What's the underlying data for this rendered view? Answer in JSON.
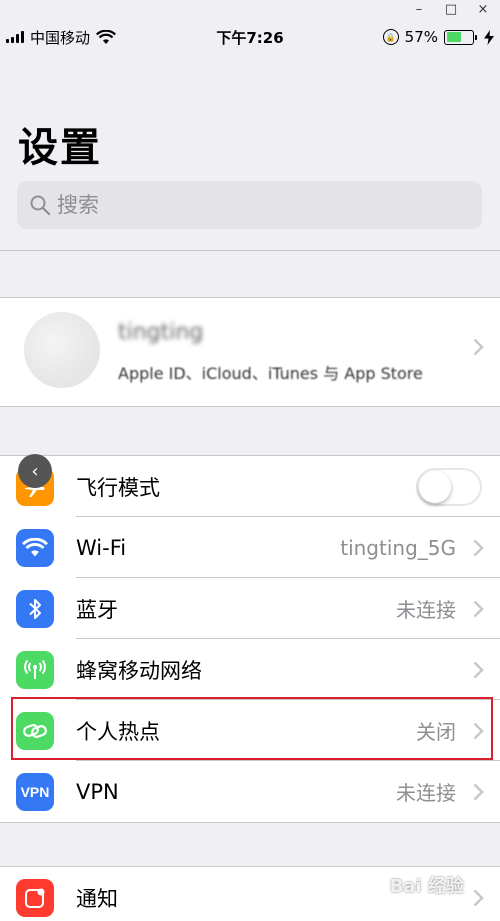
{
  "window": {
    "minimize": "–",
    "maximize": "□",
    "close": "×"
  },
  "status_bar": {
    "carrier": "中国移动",
    "time": "下午7:26",
    "battery_pct": "57%",
    "battery_level": 0.57
  },
  "title": "设置",
  "search": {
    "placeholder": "搜索"
  },
  "account": {
    "name": "tingting",
    "subtitle": "Apple ID、iCloud、iTunes 与 App Store"
  },
  "settings_rows": [
    {
      "label": "飞行模式",
      "type": "toggle",
      "value": ""
    },
    {
      "label": "Wi-Fi",
      "type": "link",
      "value": "tingting_5G"
    },
    {
      "label": "蓝牙",
      "type": "link",
      "value": "未连接"
    },
    {
      "label": "蜂窝移动网络",
      "type": "link",
      "value": ""
    },
    {
      "label": "个人热点",
      "type": "link",
      "value": "关闭"
    },
    {
      "label": "VPN",
      "type": "link",
      "value": "未连接"
    }
  ],
  "rows2": [
    {
      "label": "通知"
    }
  ],
  "vpn_icon_text": "VPN",
  "colors": {
    "airplane": "#ff9500",
    "wifi": "#3478f6",
    "bluetooth": "#3478f6",
    "cellular": "#4cd964",
    "hotspot": "#4cd964",
    "vpn": "#3478f6",
    "notifications": "#ff3b30",
    "highlight": "#d9202a"
  },
  "watermark": "Bai 经验"
}
